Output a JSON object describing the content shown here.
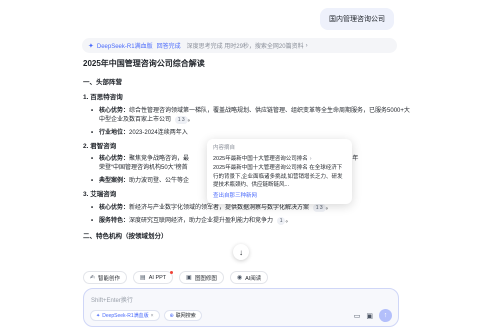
{
  "user_message": "国内管理咨询公司",
  "status": {
    "model": "DeepSeek-R1满血版",
    "done": "回答完成",
    "meta": "深度思考完成 用时29秒，搜索全网20篇资料"
  },
  "doc": {
    "title": "2025年中国管理咨询公司综合解读",
    "section1": "一、头部阵营",
    "company1": "1. 百思特咨询",
    "c1_adv_label": "核心优势：",
    "c1_adv": "综合性管理咨询领域第一梯队，覆盖战略规划、供应链管理、组织变革等全生命周期服务，已服务5000+大中型企业及数百家上市公司",
    "c1_cites": [
      "1",
      "3"
    ],
    "c1_rank_label": "行业地位：",
    "c1_rank": "2023-2024连续两年入",
    "company2": "2. 君智咨询",
    "c2_adv_label": "核心优势：",
    "c2_adv": "聚焦竞争战略咨询，最",
    "c2_adv_tail": "2024年",
    "c2_adv2": "荣登“中国管理咨询机构50大”榜首",
    "c2_case_label": "典型案例：",
    "c2_case": "助力波司登、公牛等企",
    "company3": "3. 艾瑞咨询",
    "c3_adv_label": "核心优势：",
    "c3_adv": "新经济与产业数字化领域的领军者，提供数据洞察与数字化解决方案",
    "c3_adv_cites": [
      "1",
      "3"
    ],
    "c3_svc_label": "服务特色：",
    "c3_svc": "深度研究互联网经济，助力企业提升盈利能力和竞争力",
    "c3_svc_cites": [
      "1"
    ],
    "section2": "二、特色机构（按领域划分）"
  },
  "popup": {
    "label": "内容摘自",
    "link": "2025年最新中国十大管理咨询公司排名",
    "desc": "2025年最新中国十大管理咨询公司排名 在全球经济下行的背景下,企业面临诸多挑战,如营销增长乏力、研发提技术瓶颈约、供应链断链风...",
    "more": "查出自那三种新网"
  },
  "chips": [
    {
      "icon": "✍",
      "icon_name": "pen-icon",
      "label": "智能创作",
      "dot": false
    },
    {
      "icon": "▤",
      "icon_name": "ppt-icon",
      "label": "AI PPT",
      "dot": true
    },
    {
      "icon": "▣",
      "icon_name": "image-icon",
      "label": "图图修图",
      "dot": false
    },
    {
      "icon": "◉",
      "icon_name": "read-icon",
      "label": "AI阅读",
      "dot": false
    }
  ],
  "input": {
    "placeholder": "Shift+Enter换行",
    "model_tag": "DeepSeek-R1满血版",
    "search_tag": "联网搜索"
  }
}
